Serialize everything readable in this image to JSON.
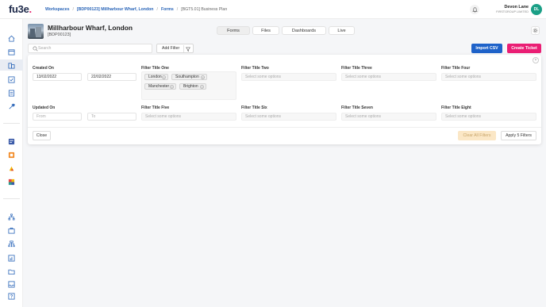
{
  "brand": {
    "logo_text": "fu3e",
    "logo_dot": "."
  },
  "breadcrumb": {
    "items": [
      "Workspaces",
      "[BDP00123] Millharbour Wharf, London",
      "Forms"
    ],
    "current": "[BGT5.01] Business Plan",
    "separator": "/"
  },
  "user": {
    "name": "Devon Lane",
    "org": "FIRSTGROUP LIMITED",
    "initials": "DL"
  },
  "sidebar": {
    "icons": [
      "home-icon",
      "calendar-icon",
      "building-icon",
      "checklist-icon",
      "document-icon",
      "wrench-icon",
      "app-blue-icon",
      "app-orange-icon",
      "app-yellow-icon",
      "app-multicolor-icon",
      "org-chart-icon",
      "briefcase-icon",
      "hierarchy-icon",
      "analytics-icon",
      "folder-icon",
      "inbox-icon",
      "help-icon"
    ],
    "active": "building-icon"
  },
  "project": {
    "title": "Millharbour Wharf, London",
    "code": "[BDP00123]"
  },
  "tabs": [
    {
      "label": "Forms",
      "active": true
    },
    {
      "label": "Files",
      "active": false
    },
    {
      "label": "Dashboards",
      "active": false
    },
    {
      "label": "Live",
      "active": false
    }
  ],
  "toolbar": {
    "search_placeholder": "Search",
    "add_filter_label": "Add Filter",
    "import_label": "Import CSV",
    "create_label": "Create Ticket"
  },
  "filters": {
    "created_on": {
      "label": "Created On",
      "from": "13/02/2022",
      "to": "22/02/2022"
    },
    "updated_on": {
      "label": "Updated On",
      "from_placeholder": "From",
      "to_placeholder": "To"
    },
    "title_one": {
      "label": "Filter Title One",
      "chips": [
        "London",
        "Southampton",
        "Manchester",
        "Brighton"
      ]
    },
    "title_two": {
      "label": "Filter Title Two",
      "placeholder": "Select some options"
    },
    "title_three": {
      "label": "Filter Title Three",
      "placeholder": "Select some options"
    },
    "title_four": {
      "label": "Filter Title Four",
      "placeholder": "Select some options"
    },
    "title_five": {
      "label": "Filter Title Five",
      "placeholder": "Select some options"
    },
    "title_six": {
      "label": "Filter Title Six",
      "placeholder": "Select some options"
    },
    "title_seven": {
      "label": "Filter Title Seven",
      "placeholder": "Select some options"
    },
    "title_eight": {
      "label": "Filter Title Eight",
      "placeholder": "Select some options"
    }
  },
  "panel_actions": {
    "close_label": "Close",
    "clear_label": "Clear All Filters",
    "apply_label": "Apply 5 Filters"
  },
  "colors": {
    "accent_blue": "#1e62c9",
    "accent_pink": "#ea1e74",
    "avatar_green": "#1a9f86",
    "clear_bg": "#fbe7c6"
  }
}
